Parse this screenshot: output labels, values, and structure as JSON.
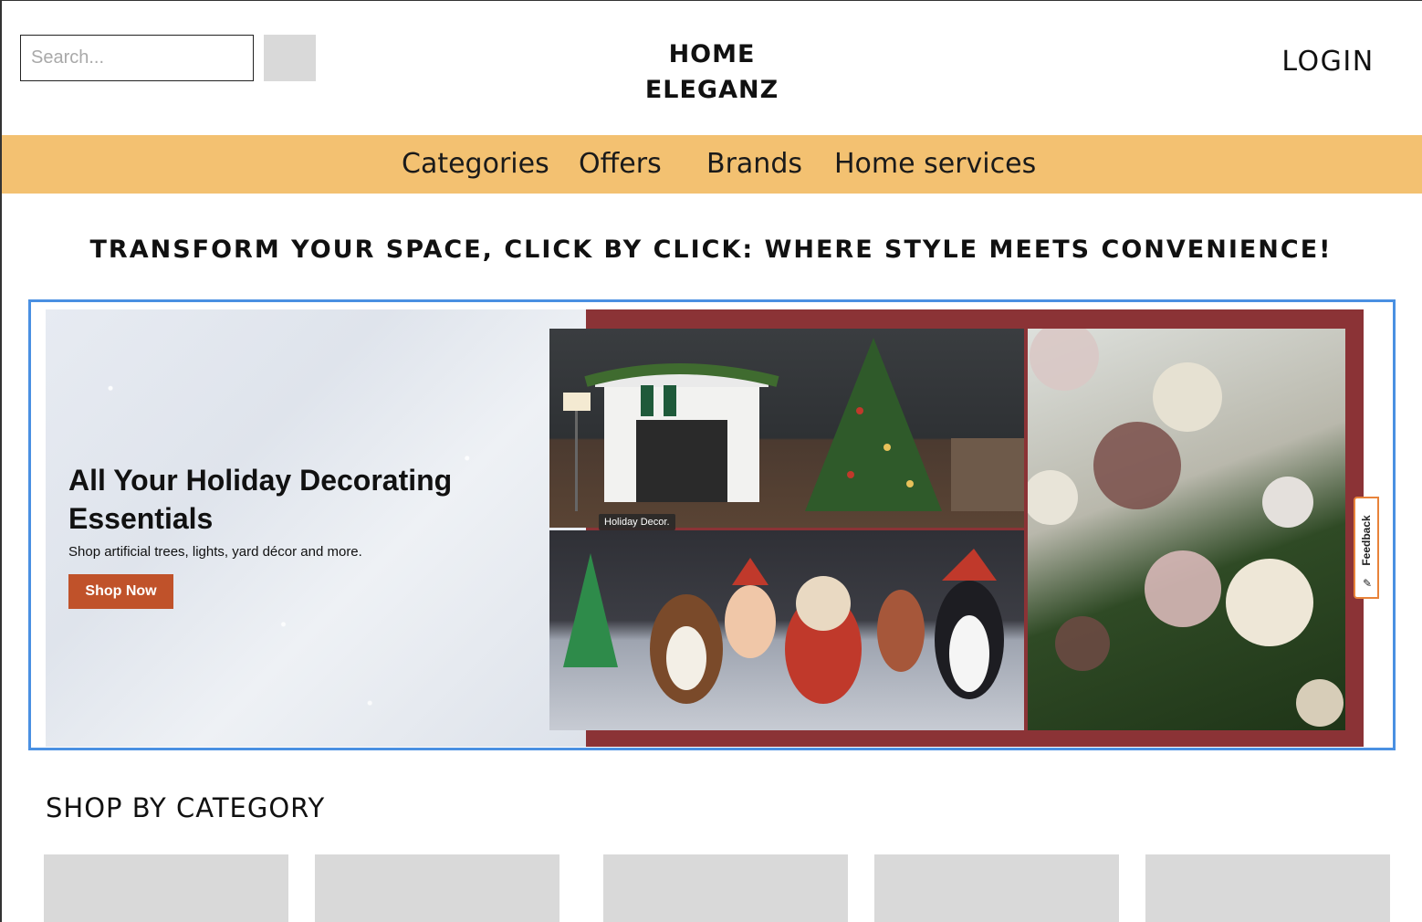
{
  "header": {
    "search_placeholder": "Search...",
    "brand_line1": "HOME",
    "brand_line2": "ELEGANZ",
    "login_label": "LOGIN"
  },
  "nav": {
    "items": [
      {
        "label": "Categories"
      },
      {
        "label": "Offers"
      },
      {
        "label": "Brands"
      },
      {
        "label": "Home services"
      }
    ]
  },
  "tagline": "TRANSFORM YOUR SPACE, CLICK BY CLICK: WHERE STYLE MEETS CONVENIENCE!",
  "banner": {
    "title": "All Your Holiday Decorating Essentials",
    "subtitle": "Shop artificial trees, lights, yard décor and more.",
    "cta_label": "Shop Now",
    "photo_caption": "Holiday Decor.",
    "feedback_label": "Feedback",
    "colors": {
      "accent_border": "#4a90e2",
      "cta": "#c0522a",
      "maroon": "#8b3336",
      "feedback_border": "#e8833a"
    }
  },
  "categories": {
    "title": "SHOP BY CATEGORY",
    "tile_count_visible": 5
  },
  "colors": {
    "nav_bg": "#f3c171",
    "placeholder_gray": "#d9d9d9"
  }
}
